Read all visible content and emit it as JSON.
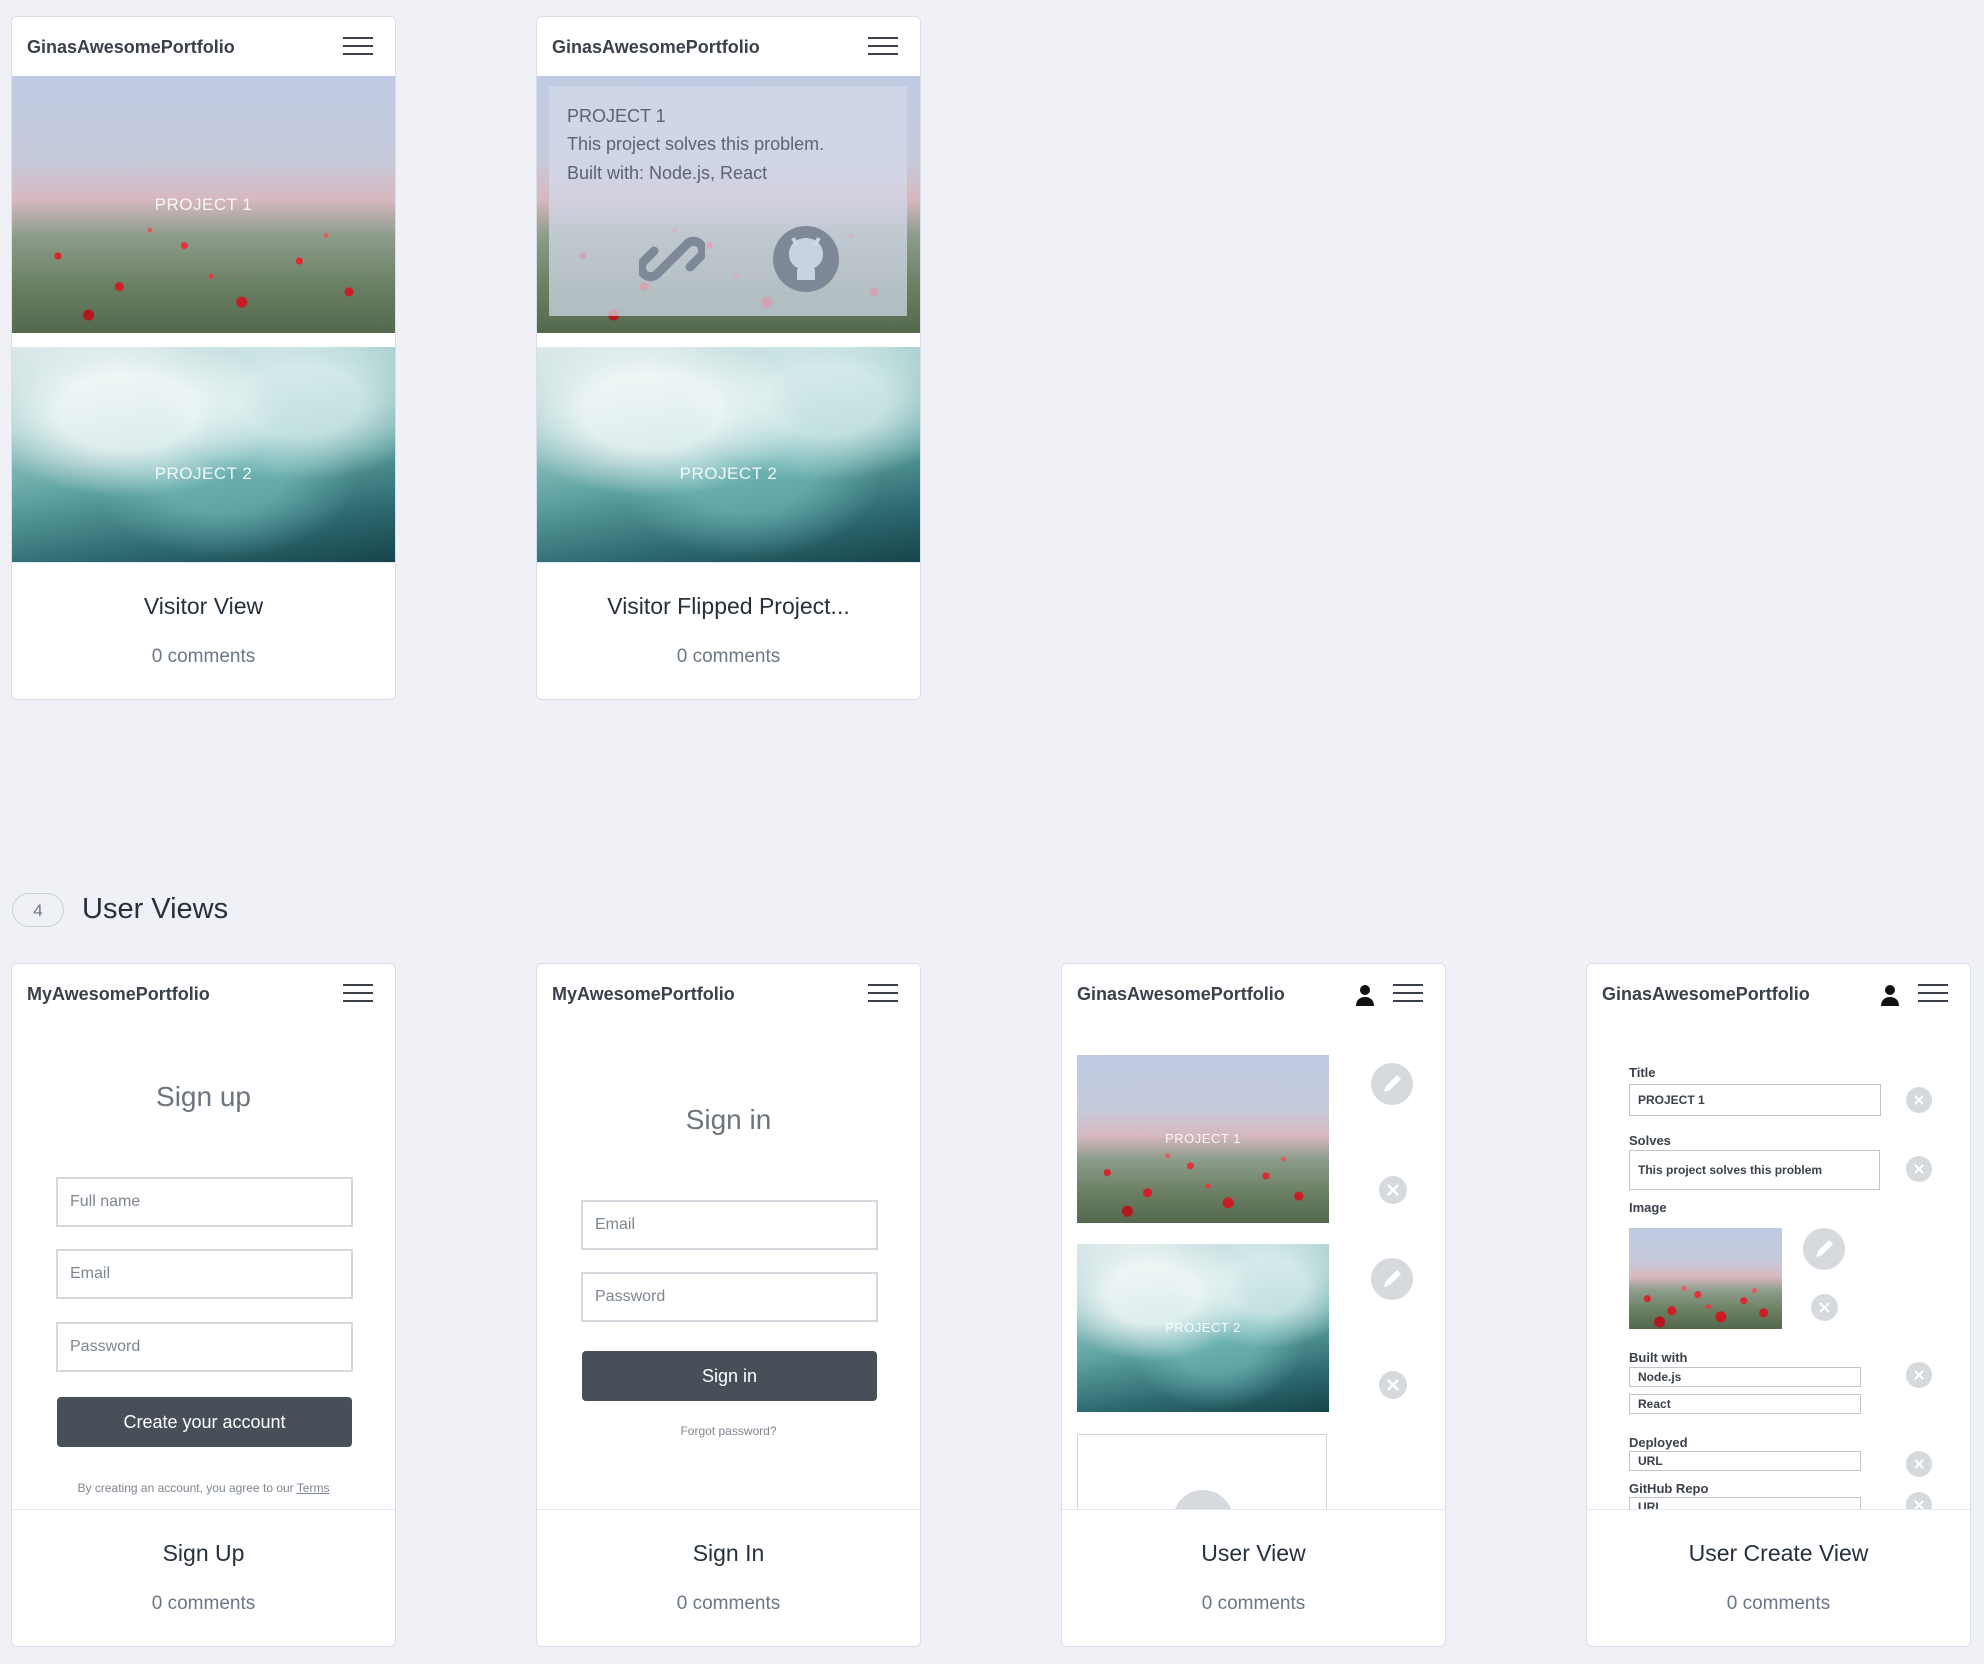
{
  "section": {
    "count": "4",
    "title": "User Views"
  },
  "cards": [
    {
      "title": "Visitor View",
      "comments": "0 comments",
      "brand": "GinasAwesomePortfolio",
      "projects": [
        "PROJECT 1",
        "PROJECT 2"
      ]
    },
    {
      "title": "Visitor Flipped Project...",
      "comments": "0 comments",
      "brand": "GinasAwesomePortfolio",
      "flip": {
        "title": "PROJECT 1",
        "solves": "This project solves this problem.",
        "built": "Built with: Node.js, React"
      },
      "projects": [
        "PROJECT 2"
      ]
    },
    {
      "title": "Sign Up",
      "comments": "0 comments",
      "brand": "MyAwesomePortfolio",
      "heading": "Sign up",
      "fullname_placeholder": "Full name",
      "email_placeholder": "Email",
      "password_placeholder": "Password",
      "button": "Create your account",
      "terms_text": "By creating an account, you agree to our",
      "terms_link": "Terms"
    },
    {
      "title": "Sign In",
      "comments": "0 comments",
      "brand": "MyAwesomePortfolio",
      "heading": "Sign in",
      "email_placeholder": "Email",
      "password_placeholder": "Password",
      "button": "Sign in",
      "forgot": "Forgot password?"
    },
    {
      "title": "User View",
      "comments": "0 comments",
      "brand": "GinasAwesomePortfolio",
      "projects": [
        "PROJECT 1",
        "PROJECT 2"
      ]
    },
    {
      "title": "User Create View",
      "comments": "0 comments",
      "brand": "GinasAwesomePortfolio",
      "labels": {
        "title": "Title",
        "solves": "Solves",
        "image": "Image",
        "built": "Built with",
        "deployed": "Deployed",
        "repo": "GitHub Repo"
      },
      "values": {
        "title": "PROJECT 1",
        "solves": "This project solves this problem",
        "built1": "Node.js",
        "built2": "React",
        "deployed": "URL",
        "repo": "URL"
      }
    }
  ],
  "icons": {
    "menu": "hamburger-menu-icon",
    "link": "link-icon",
    "github": "github-icon",
    "edit": "pencil-icon",
    "delete": "close-icon",
    "user": "person-icon"
  },
  "colors": {
    "background": "#eff1f6",
    "button_dark": "#474f58",
    "text_dark": "#26313d",
    "muted": "#6b7785"
  }
}
